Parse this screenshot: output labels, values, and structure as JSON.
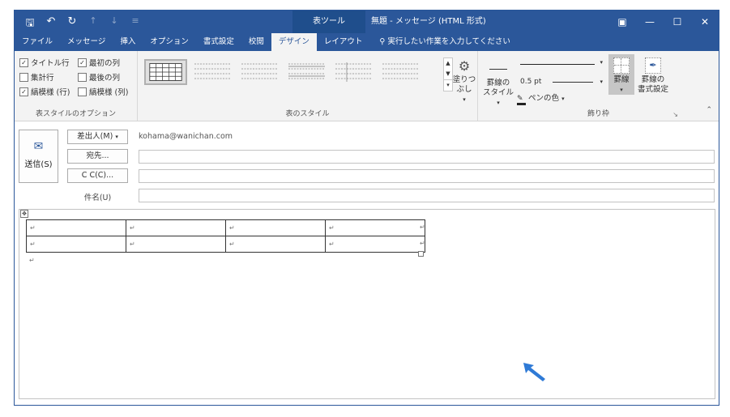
{
  "titlebar": {
    "context_tab_header": "表ツール",
    "window_title": "無題 - メッセージ (HTML 形式)"
  },
  "tabs": [
    {
      "label": "ファイル"
    },
    {
      "label": "メッセージ"
    },
    {
      "label": "挿入"
    },
    {
      "label": "オプション"
    },
    {
      "label": "書式設定"
    },
    {
      "label": "校閲"
    },
    {
      "label": "デザイン"
    },
    {
      "label": "レイアウト"
    }
  ],
  "tell_me": "実行したい作業を入力してください",
  "ribbon": {
    "table_style_options": {
      "label": "表スタイルのオプション",
      "header_row": "タイトル行",
      "first_column": "最初の列",
      "total_row": "集計行",
      "last_column": "最後の列",
      "banded_rows": "縞模様 (行)",
      "banded_columns": "縞模様 (列)"
    },
    "table_styles": {
      "label": "表のスタイル",
      "shading": "塗りつぶし"
    },
    "borders": {
      "label": "飾り枠",
      "border_styles_line1": "罫線の",
      "border_styles_line2": "スタイル",
      "line_weight": "0.5 pt",
      "pen_color": "ペンの色",
      "borders_button": "罫線",
      "border_painter_line1": "罫線の",
      "border_painter_line2": "書式設定"
    }
  },
  "compose": {
    "send": "送信(S)",
    "from_button": "差出人(M)",
    "from_value": "kohama@wanichan.com",
    "to_button": "宛先...",
    "cc_button": "C C(C)...",
    "subject_label": "件名(U)"
  },
  "colors": {
    "accent": "#2b579a"
  }
}
